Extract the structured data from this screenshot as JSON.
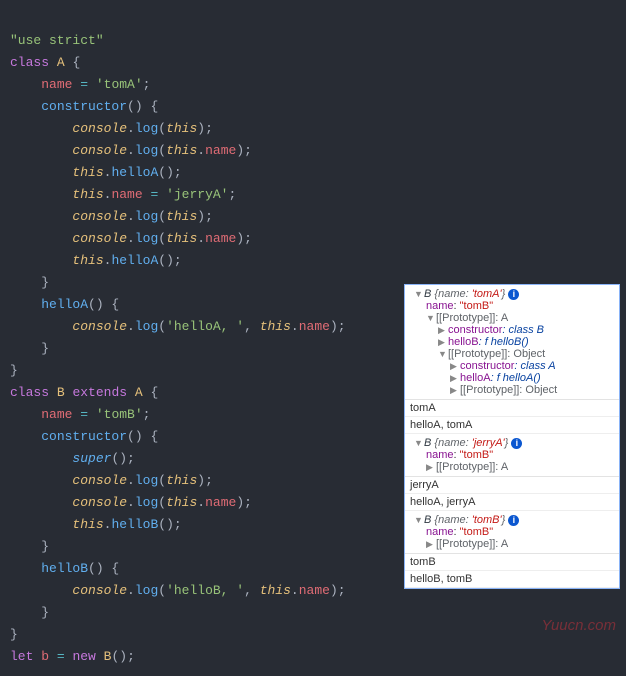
{
  "code": {
    "l1": "\"use strict\"",
    "l2_kw": "class",
    "l2_name": "A",
    "l2_b": " {",
    "l3_prop": "name",
    "l3_eq": " = ",
    "l3_val": "'tomA'",
    "l3_s": ";",
    "l4_fn": "constructor",
    "l4_p": "() {",
    "l5_obj": "console",
    "l5_fn": "log",
    "l5_t": "this",
    "l5_e": ");",
    "l6_obj": "console",
    "l6_fn": "log",
    "l6_t": "this",
    "l6_prop": "name",
    "l6_e": ");",
    "l7_t": "this",
    "l7_fn": "helloA",
    "l7_e": "();",
    "l8_t": "this",
    "l8_prop": "name",
    "l8_eq": " = ",
    "l8_val": "'jerryA'",
    "l8_s": ";",
    "l9_obj": "console",
    "l9_fn": "log",
    "l9_t": "this",
    "l9_e": ");",
    "l10_obj": "console",
    "l10_fn": "log",
    "l10_t": "this",
    "l10_prop": "name",
    "l10_e": ");",
    "l11_t": "this",
    "l11_fn": "helloA",
    "l11_e": "();",
    "l12": "}",
    "l13_fn": "helloA",
    "l13_p": "() {",
    "l14_obj": "console",
    "l14_fn": "log",
    "l14_s1": "'helloA, '",
    "l14_c": ", ",
    "l14_t": "this",
    "l14_prop": "name",
    "l14_e": ");",
    "l15": "}",
    "l16": "}",
    "l17_kw": "class",
    "l17_name": "B",
    "l17_ext": "extends",
    "l17_sup": "A",
    "l17_b": " {",
    "l18_prop": "name",
    "l18_eq": " = ",
    "l18_val": "'tomB'",
    "l18_s": ";",
    "l19_fn": "constructor",
    "l19_p": "() {",
    "l20_fn": "super",
    "l20_e": "();",
    "l21_obj": "console",
    "l21_fn": "log",
    "l21_t": "this",
    "l21_e": ");",
    "l22_obj": "console",
    "l22_fn": "log",
    "l22_t": "this",
    "l22_prop": "name",
    "l22_e": ");",
    "l23_t": "this",
    "l23_fn": "helloB",
    "l23_e": "();",
    "l24": "}",
    "l25_fn": "helloB",
    "l25_p": "() {",
    "l26_obj": "console",
    "l26_fn": "log",
    "l26_s1": "'helloB, '",
    "l26_c": ", ",
    "l26_t": "this",
    "l26_prop": "name",
    "l26_e": ");",
    "l27": "}",
    "l28": "}",
    "l29_kw": "let",
    "l29_v": "b",
    "l29_eq": " = ",
    "l29_new": "new",
    "l29_cls": "B",
    "l29_e": "();"
  },
  "console": {
    "g1_head_cls": "B ",
    "g1_head_obj": "{name: ",
    "g1_head_val": "'tomA'",
    "g1_head_end": "}",
    "g1_name_k": "name",
    "g1_name_c": ": ",
    "g1_name_v": "\"tomB\"",
    "g1_proto1": "[[Prototype]]: A",
    "g1_ctor1_k": "constructor",
    "g1_ctor1_v": ": class B",
    "g1_hellob_k": "helloB",
    "g1_hellob_v": ": f helloB()",
    "g1_proto2": "[[Prototype]]: Object",
    "g1_ctor2_k": "constructor",
    "g1_ctor2_v": ": class A",
    "g1_helloa_k": "helloA",
    "g1_helloa_v": ": f helloA()",
    "g1_proto3": "[[Prototype]]: Object",
    "r1": "tomA",
    "r2": "helloA,  tomA",
    "g2_head_cls": "B ",
    "g2_head_obj": "{name: ",
    "g2_head_val": "'jerryA'",
    "g2_head_end": "}",
    "g2_name_k": "name",
    "g2_name_c": ": ",
    "g2_name_v": "\"tomB\"",
    "g2_proto1": "[[Prototype]]: A",
    "r3": "jerryA",
    "r4": "helloA,  jerryA",
    "g3_head_cls": "B ",
    "g3_head_obj": "{name: ",
    "g3_head_val": "'tomB'",
    "g3_head_end": "}",
    "g3_name_k": "name",
    "g3_name_c": ": ",
    "g3_name_v": "\"tomB\"",
    "g3_proto1": "[[Prototype]]: A",
    "r5": "tomB",
    "r6": "helloB,  tomB",
    "info": "i"
  },
  "watermark": "Yuucn.com"
}
